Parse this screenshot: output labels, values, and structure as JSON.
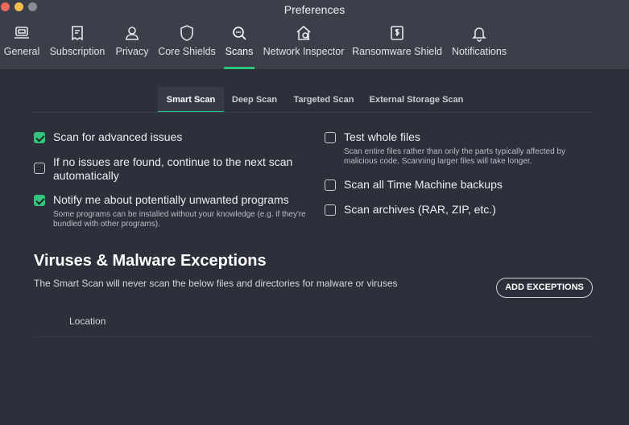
{
  "window": {
    "title": "Preferences"
  },
  "toolbar": {
    "items": [
      {
        "label": "General",
        "icon": "laptop-icon"
      },
      {
        "label": "Subscription",
        "icon": "receipt-icon"
      },
      {
        "label": "Privacy",
        "icon": "person-icon"
      },
      {
        "label": "Core Shields",
        "icon": "shield-icon"
      },
      {
        "label": "Scans",
        "icon": "magnifier-scan-icon",
        "active": true
      },
      {
        "label": "Network Inspector",
        "icon": "home-network-icon"
      },
      {
        "label": "Ransomware Shield",
        "icon": "ransomware-icon"
      },
      {
        "label": "Notifications",
        "icon": "bell-icon"
      }
    ],
    "accent_color": "#2ec27e"
  },
  "subtabs": [
    {
      "label": "Smart Scan",
      "active": true
    },
    {
      "label": "Deep Scan"
    },
    {
      "label": "Targeted Scan"
    },
    {
      "label": "External Storage Scan"
    }
  ],
  "options": {
    "advanced_issues": {
      "label": "Scan for advanced issues",
      "checked": true
    },
    "continue_next": {
      "label_line1": "If no issues are found, continue to the next scan",
      "label_line2": "automatically",
      "checked": false
    },
    "pup": {
      "label": "Notify me about potentially unwanted programs",
      "desc_line1": "Some programs can be installed without your knowledge (e.g. if they're",
      "desc_line2": "bundled with other programs).",
      "checked": true
    },
    "whole_files": {
      "label": "Test whole files",
      "desc_line1": "Scan entire files rather than only the parts typically affected by",
      "desc_line2": "malicious code. Scanning larger files will take longer.",
      "checked": false
    },
    "time_machine": {
      "label": "Scan all Time Machine backups",
      "checked": false
    },
    "archives": {
      "label": "Scan archives (RAR, ZIP, etc.)",
      "checked": false
    }
  },
  "exceptions": {
    "title": "Viruses & Malware Exceptions",
    "description": "The Smart Scan will never scan the below files and directories for malware or viruses",
    "add_button": "ADD EXCEPTIONS",
    "column_header": "Location"
  },
  "colors": {
    "background": "#2b303b",
    "titlebar": "#3a3f4a",
    "check": "#34c27f"
  }
}
